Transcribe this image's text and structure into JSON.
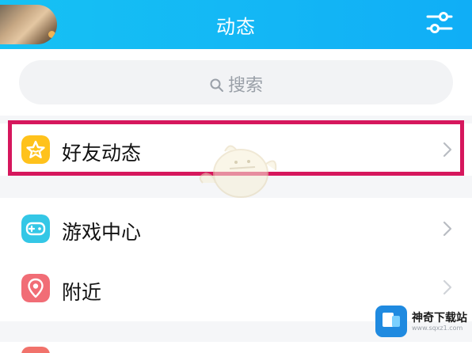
{
  "header": {
    "title": "动态",
    "avatar_icon": "user-avatar-icon",
    "settings_icon": "filter-settings-icon",
    "background_color": "#13b6f5"
  },
  "search": {
    "placeholder": "搜索",
    "icon": "search-icon"
  },
  "menu": {
    "items": [
      {
        "label": "好友动态",
        "icon": "star-icon",
        "icon_color": "#ffc21c",
        "highlighted": true
      },
      {
        "label": "游戏中心",
        "icon": "gamepad-icon",
        "icon_color": "#34c7e6",
        "highlighted": false
      },
      {
        "label": "附近",
        "icon": "location-pin-icon",
        "icon_color": "#f16d76",
        "highlighted": false
      }
    ]
  },
  "highlight_color": "#d6175d",
  "watermark": {
    "text": "神奇下载站",
    "sub": "www.sqxz1.com"
  }
}
